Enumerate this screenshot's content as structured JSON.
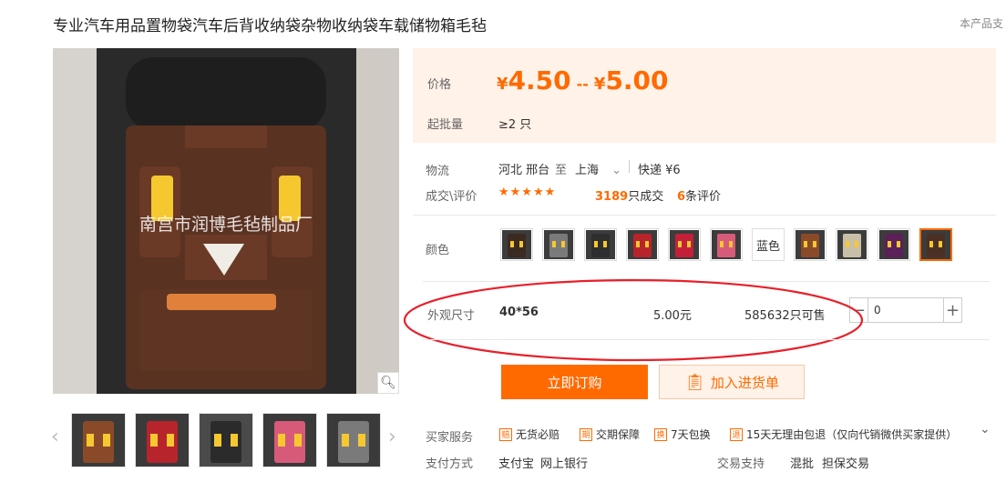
{
  "product": {
    "title": "专业汽车用品置物袋汽车后背收纳袋杂物收纳袋车载储物箱毛毡",
    "top_right_text": "本产品支",
    "watermark": "南宫市润博毛毡制品厂"
  },
  "price": {
    "label": "价格",
    "currency": "¥",
    "min": "4.50",
    "separator": "--",
    "max": "5.00",
    "moq_label": "起批量",
    "moq_value": "≥2 只"
  },
  "logistics": {
    "label": "物流",
    "from": "河北 邢台",
    "to_word": "至",
    "to": "上海",
    "express": "快递 ¥6"
  },
  "deals": {
    "label": "成交\\评价",
    "stars": "★★★★★",
    "count": "3189",
    "count_suffix": "只成交",
    "reviews": "6",
    "reviews_suffix": "条评价"
  },
  "colors": {
    "label": "颜色",
    "text_option": "蓝色",
    "swatches": [
      "#3a2a22",
      "#7a7a7a",
      "#2e2e2e",
      "#b8242c",
      "#c41f3a",
      "#d85a7a",
      "text",
      "#8a4a2a",
      "#c9bfa8",
      "#5b1f5a",
      "#4a3024"
    ],
    "accent": "#ff6a00"
  },
  "size_row": {
    "label": "外观尺寸",
    "size": "40*56",
    "price": "5.00元",
    "stock": "585632只可售",
    "minus": "−",
    "plus": "+",
    "quantity": "0"
  },
  "actions": {
    "buy": "立即订购",
    "cart": "加入进货单"
  },
  "services": {
    "label": "买家服务",
    "items": [
      "无货必赔",
      "交期保障",
      "7天包换",
      "15天无理由包退（仅向代销微供买家提供）"
    ],
    "icons": [
      "赔",
      "期",
      "换",
      "退"
    ]
  },
  "payment": {
    "label": "支付方式",
    "methods": [
      "支付宝",
      "网上银行"
    ],
    "trade_label": "交易支持",
    "trade": [
      "混批",
      "担保交易"
    ]
  }
}
